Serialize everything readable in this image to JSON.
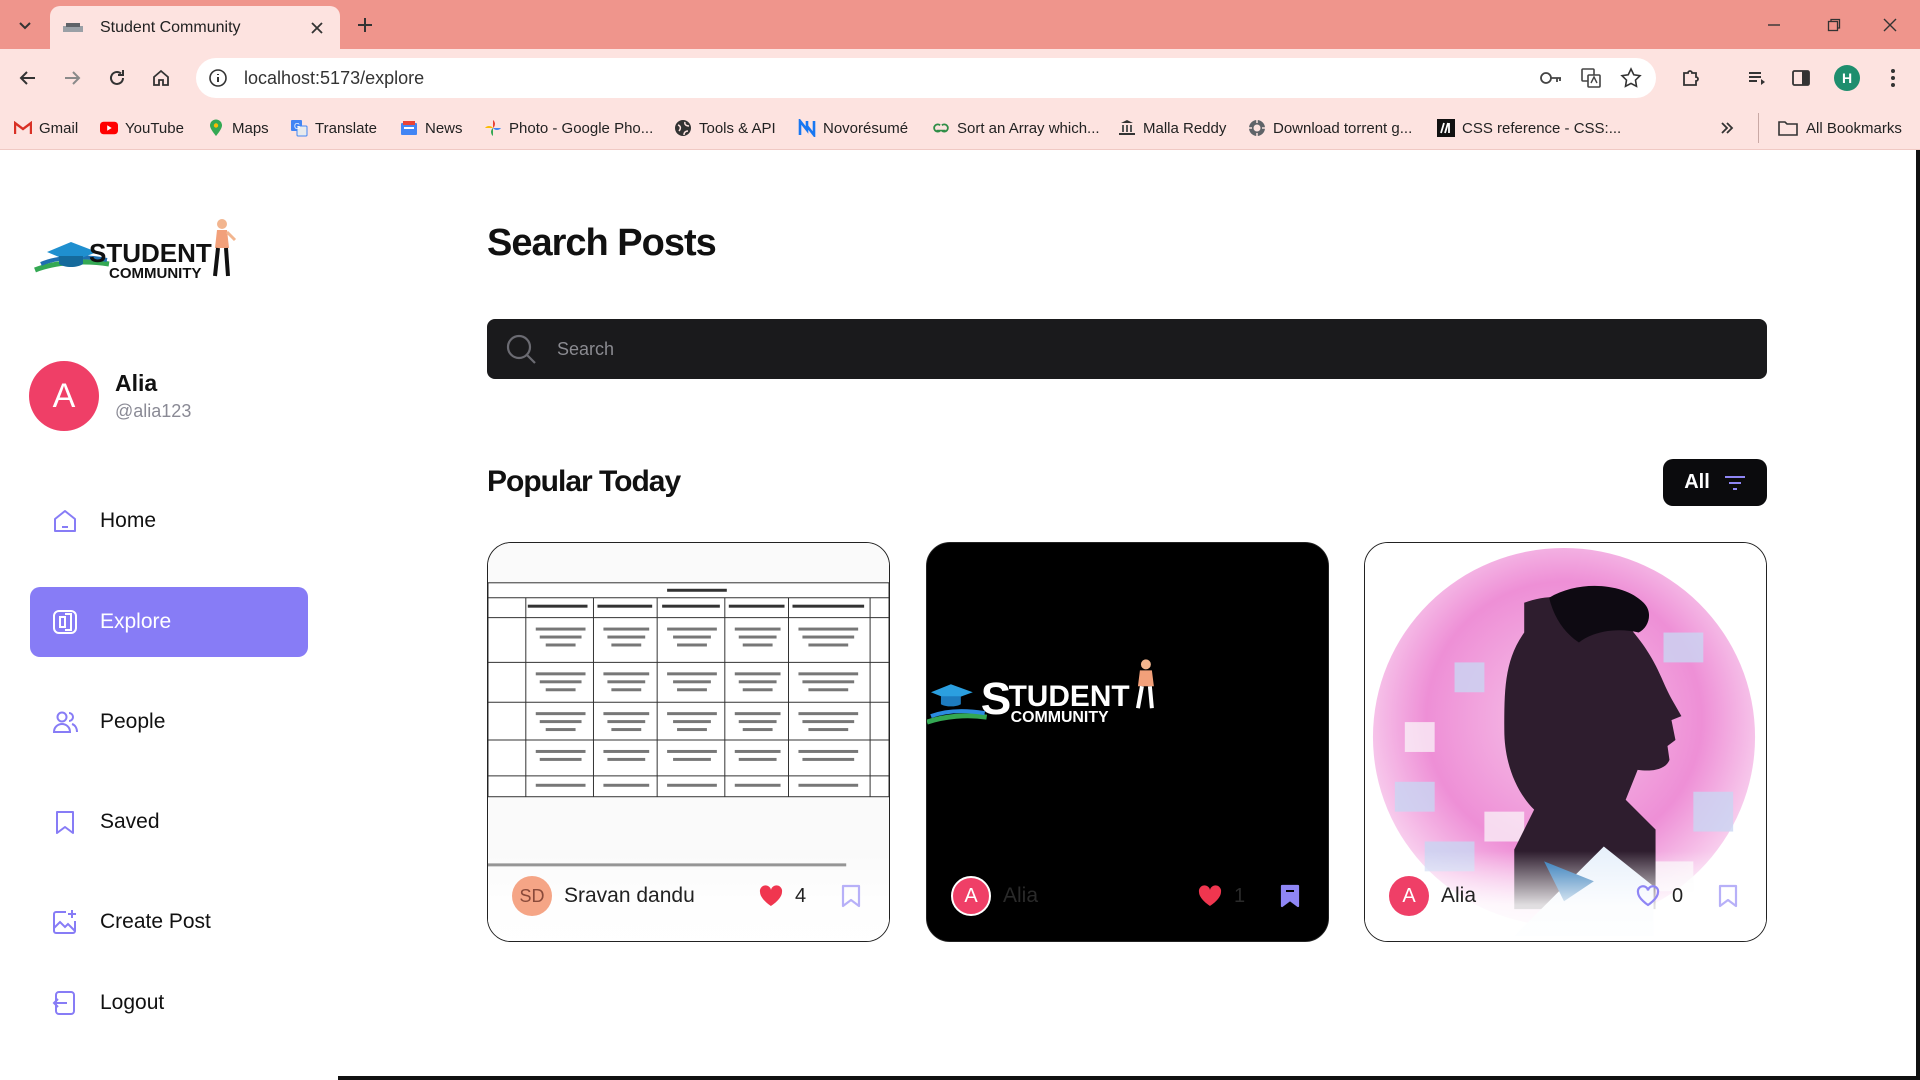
{
  "browser": {
    "tab_title": "Student Community",
    "url": "localhost:5173/explore",
    "profile_initial": "H",
    "bookmarks": [
      {
        "label": "Gmail",
        "icon": "gmail-icon"
      },
      {
        "label": "YouTube",
        "icon": "youtube-icon"
      },
      {
        "label": "Maps",
        "icon": "maps-icon"
      },
      {
        "label": "Translate",
        "icon": "translate-icon"
      },
      {
        "label": "News",
        "icon": "news-icon"
      },
      {
        "label": "Photo - Google Pho...",
        "icon": "photos-icon"
      },
      {
        "label": "Tools & API",
        "icon": "globe-icon"
      },
      {
        "label": "Novorésumé",
        "icon": "novoresume-icon"
      },
      {
        "label": "Sort an Array which...",
        "icon": "gfg-icon"
      },
      {
        "label": "Malla Reddy",
        "icon": "malla-reddy-icon"
      },
      {
        "label": "Download torrent g...",
        "icon": "torrent-icon"
      },
      {
        "label": "CSS reference - CSS:...",
        "icon": "mdn-icon"
      }
    ],
    "all_bookmarks": "All Bookmarks"
  },
  "sidebar": {
    "user": {
      "initial": "A",
      "name": "Alia",
      "handle": "@alia123"
    },
    "nav": [
      {
        "label": "Home",
        "icon": "home-icon",
        "active": false
      },
      {
        "label": "Explore",
        "icon": "explore-icon",
        "active": true
      },
      {
        "label": "People",
        "icon": "people-icon",
        "active": false
      },
      {
        "label": "Saved",
        "icon": "bookmark-icon",
        "active": false
      },
      {
        "label": "Create Post",
        "icon": "create-post-icon",
        "active": false
      },
      {
        "label": "Logout",
        "icon": "logout-icon",
        "active": false
      }
    ]
  },
  "main": {
    "title": "Search Posts",
    "search_placeholder": "Search",
    "section_title": "Popular Today",
    "filter_label": "All",
    "posts": [
      {
        "author_initials": "SD",
        "author": "Sravan dandu",
        "likes": "4",
        "liked": true,
        "saved": false
      },
      {
        "author_initials": "A",
        "author": "Alia",
        "likes": "1",
        "liked": true,
        "saved": true
      },
      {
        "author_initials": "A",
        "author": "Alia",
        "likes": "0",
        "liked": false,
        "saved": false
      }
    ]
  },
  "colors": {
    "accent": "#877cf6",
    "avatar": "#ef3f67",
    "like": "#f0364f",
    "chrome_tab": "#ef958c",
    "chrome_toolbar": "#fde3e0"
  }
}
